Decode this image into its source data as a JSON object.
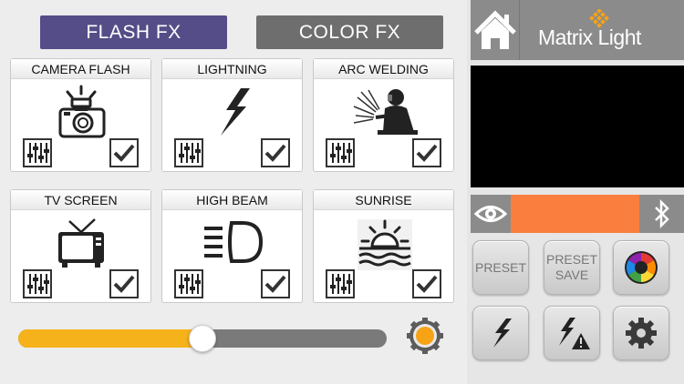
{
  "tabs": {
    "flash_label": "FLASH FX",
    "color_label": "COLOR FX"
  },
  "effects": [
    {
      "title": "CAMERA FLASH",
      "icon": "camera-flash-icon",
      "checked": true
    },
    {
      "title": "LIGHTNING",
      "icon": "lightning-bolt-icon",
      "checked": true
    },
    {
      "title": "ARC WELDING",
      "icon": "welder-icon",
      "checked": true
    },
    {
      "title": "TV SCREEN",
      "icon": "tv-icon",
      "checked": true
    },
    {
      "title": "HIGH BEAM",
      "icon": "headlight-icon",
      "checked": true
    },
    {
      "title": "SUNRISE",
      "icon": "sunrise-icon",
      "checked": true
    }
  ],
  "intensity": {
    "fraction": 0.5,
    "fill_color": "#f6b21a"
  },
  "brand": {
    "name": "Matrix Light"
  },
  "color_swatch": "#fa7f3f",
  "buttons": {
    "preset_label": "PRESET",
    "preset_save_line1": "PRESET",
    "preset_save_line2": "SAVE"
  },
  "colors": {
    "accent": "#554d87",
    "header_gray": "#8b8b8b"
  }
}
